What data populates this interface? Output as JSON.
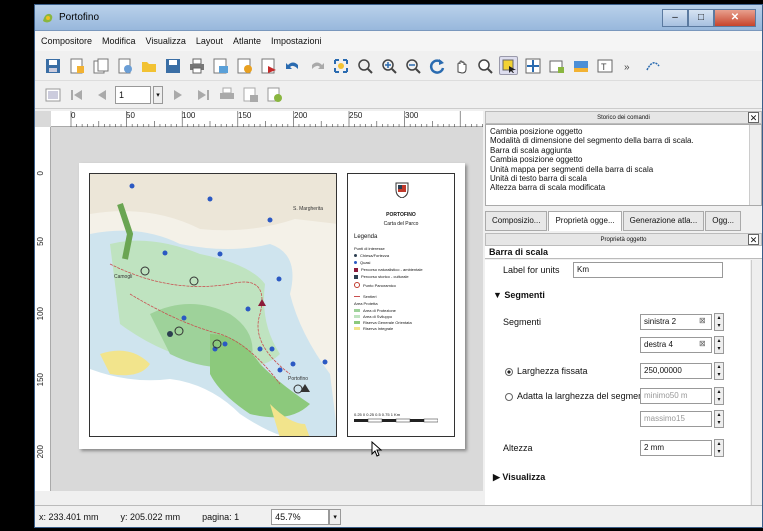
{
  "window": {
    "title": "Portofino",
    "min": "–",
    "max": "□",
    "close": "✕"
  },
  "menu": [
    "Compositore",
    "Modifica",
    "Visualizza",
    "Layout",
    "Atlante",
    "Impostazioni"
  ],
  "toolbar2": {
    "page_value": "1"
  },
  "ruler": {
    "top_labels": [
      "0",
      "50",
      "100",
      "150",
      "200",
      "250",
      "300"
    ],
    "left_labels": [
      "0",
      "50",
      "100",
      "150",
      "200"
    ]
  },
  "map": {
    "place_labels": [
      "S. Margherita",
      "Camogli",
      "Portofino"
    ],
    "legend": {
      "title": "PORTOFINO",
      "subtitle": "Carta del Parco",
      "heading": "Legenda",
      "groups": [
        "Punti di interesse",
        "Area Protetta"
      ],
      "items": [
        "Chiesa/Fortezza",
        "Quasi",
        "Percorso naturalistico - ambientale",
        "Percorso storico - culturale",
        "Punto Panoramico",
        "Sentieri",
        "Area di Protezione",
        "Area di Sviluppo",
        "Riserva Generale Orientata",
        "Riserva Integrale"
      ],
      "scale_label": "0.25  0  0.25  0.5  0.75  1 Km"
    }
  },
  "status": {
    "x": "x: 233.401 mm",
    "y": "y: 205.022 mm",
    "page": "pagina: 1",
    "zoom": "45.7%"
  },
  "history": {
    "title": "Storico dei comandi",
    "items": [
      "Cambia posizione oggetto",
      "Modalità di dimensione del segmento della barra di scala.",
      "Barra di scala aggiunta",
      "Cambia posizione oggetto",
      "Unità mappa per segmenti della barra di scala",
      "Unità di testo barra di scala",
      "Altezza barra di scala modificata"
    ]
  },
  "tabs": [
    "Composizio...",
    "Proprietà ogge...",
    "Generazione atla...",
    "Ogg..."
  ],
  "props": {
    "panel_title": "Proprietà oggetto",
    "section": "Barra di scala",
    "label_for_units": "Label for units",
    "units_value": "Km",
    "segmenti_header": "Segmenti",
    "segmenti_label": "Segmenti",
    "left_segments": "sinistra 2",
    "right_segments": "destra 4",
    "fixed_width_label": "Larghezza fissata",
    "fixed_width_value": "250,00000",
    "fit_width_label": "Adatta la larghezza del segmento",
    "min_value": "minimo50 m",
    "max_value": "massimo15",
    "height_label": "Altezza",
    "height_value": "2 mm",
    "visualizza_header": "Visualizza"
  },
  "colors": {
    "title_gradient": "#b9d1ea",
    "accent": "#3b5f8a",
    "close": "#c7442c"
  }
}
